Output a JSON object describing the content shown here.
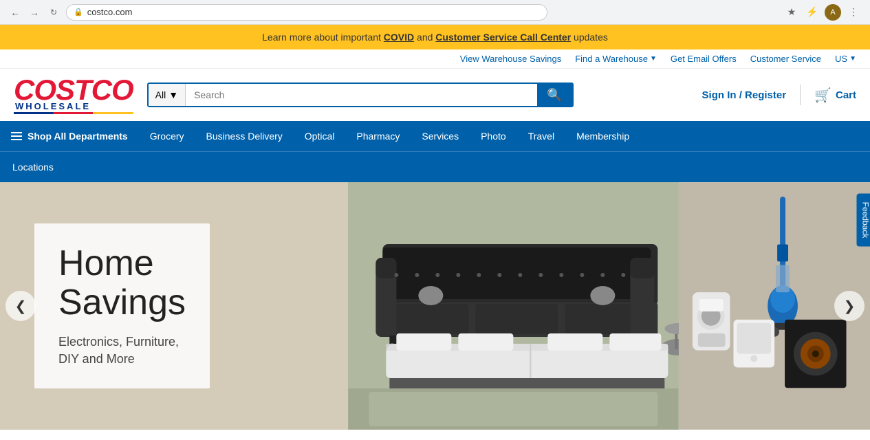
{
  "browser": {
    "url": "costco.com",
    "back_label": "←",
    "forward_label": "→",
    "refresh_label": "↻"
  },
  "announcement": {
    "text_before": "Learn more about important ",
    "covid_link": "COVID",
    "text_middle": " and ",
    "cs_link": "Customer Service Call Center",
    "text_after": " updates"
  },
  "utility_nav": {
    "warehouse_savings": "View Warehouse Savings",
    "find_warehouse": "Find a Warehouse",
    "email_offers": "Get Email Offers",
    "customer_service": "Customer Service",
    "country": "US"
  },
  "header": {
    "logo_costco": "COSTCO",
    "logo_wholesale": "WHOLESALE",
    "search_category": "All",
    "search_placeholder": "Search",
    "signin_label": "Sign In / Register",
    "cart_label": "Cart"
  },
  "main_nav": {
    "all_depts": "Shop All Departments",
    "items": [
      "Grocery",
      "Business Delivery",
      "Optical",
      "Pharmacy",
      "Services",
      "Photo",
      "Travel",
      "Membership"
    ]
  },
  "secondary_nav": {
    "items": [
      "Locations"
    ]
  },
  "hero": {
    "title": "Home\nSavings",
    "subtitle": "Electronics, Furniture,\nDIY and More"
  },
  "feedback": {
    "label": "Feedback"
  },
  "colors": {
    "blue": "#0060A9",
    "red": "#E31837",
    "yellow": "#FFC220",
    "dark_blue": "#003087"
  }
}
